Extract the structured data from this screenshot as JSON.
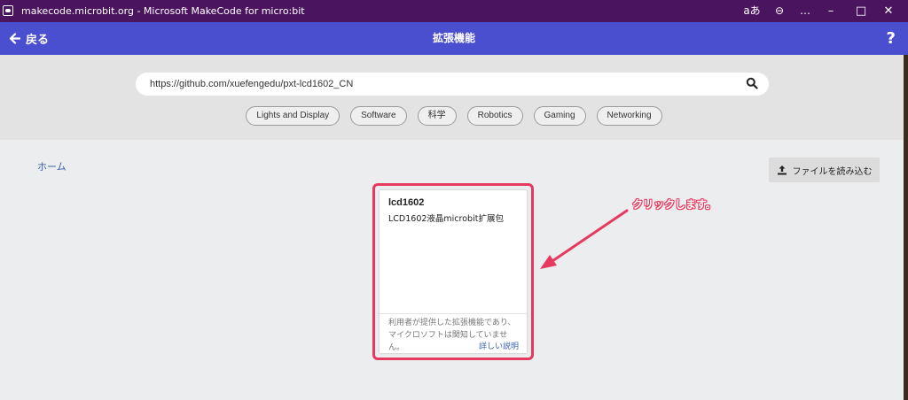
{
  "window": {
    "title": "makecode.microbit.org - Microsoft MakeCode for micro:bit",
    "controls": {
      "read_aloud": "aあ",
      "zoom": "⊖",
      "more": "…",
      "minimize": "–",
      "maximize": "□",
      "close": "✕"
    }
  },
  "header": {
    "back_label": "戻る",
    "title": "拡張機能",
    "help": "?"
  },
  "search": {
    "value": "https://github.com/xuefengedu/pxt-lcd1602_CN",
    "icon": "search-icon"
  },
  "tags": [
    "Lights and Display",
    "Software",
    "科学",
    "Robotics",
    "Gaming",
    "Networking"
  ],
  "breadcrumb": {
    "home": "ホーム"
  },
  "upload": {
    "label": "ファイルを読み込む",
    "icon": "upload-icon"
  },
  "card": {
    "title": "lcd1602",
    "description": "LCD1602液晶microbit扩展包",
    "disclaimer": "利用者が提供した拡張機能であり、マイクロソフトは関知していません。",
    "learn_more": "詳しい説明"
  },
  "annotation": {
    "text": "クリックします。",
    "color": "#e5395f"
  },
  "colors": {
    "titlebar": "#4a145f",
    "header": "#4a4fd0",
    "accent": "#e5395f",
    "link": "#3b5fab"
  }
}
